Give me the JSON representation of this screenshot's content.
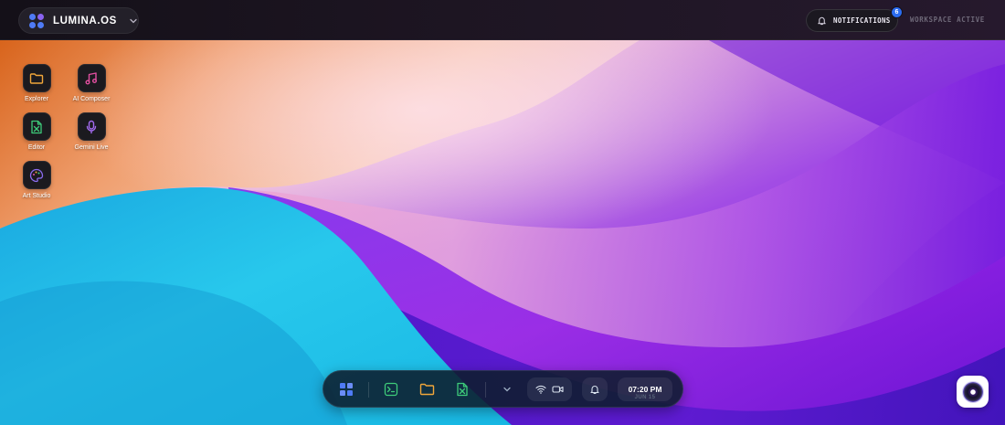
{
  "topbar": {
    "brand_name": "LUMINA.OS",
    "brand_icon": "apps-grid-icon",
    "brand_menu_icon": "chevron-down-icon",
    "notifications": {
      "label": "NOTIFICATIONS",
      "icon": "bell-icon",
      "count": "6"
    },
    "workspace_status": "WORKSPACE ACTIVE"
  },
  "desktop": {
    "icons": [
      {
        "label": "Explorer",
        "icon": "folder-icon",
        "color": "#f0a63a"
      },
      {
        "label": "AI Composer",
        "icon": "music-note-icon",
        "color": "#e24fa0"
      },
      {
        "label": "Editor",
        "icon": "spreadsheet-icon",
        "color": "#3ecb7a"
      },
      {
        "label": "Gemini Live",
        "icon": "microphone-icon",
        "color": "#a46bf0"
      },
      {
        "label": "Art Studio",
        "icon": "palette-icon",
        "color": "#8b6cf0"
      }
    ]
  },
  "dock": {
    "apps": [
      {
        "name": "launcher",
        "icon": "apps-grid-icon"
      },
      {
        "name": "terminal",
        "icon": "terminal-icon"
      },
      {
        "name": "explorer",
        "icon": "folder-icon"
      },
      {
        "name": "editor",
        "icon": "spreadsheet-icon"
      }
    ],
    "expand_icon": "chevron-down-icon",
    "status_icons": [
      "wifi-icon",
      "video-camera-icon"
    ],
    "alerts_icon": "bell-icon",
    "clock": {
      "time": "07:20 PM",
      "date": "JUN 15"
    }
  },
  "assistant": {
    "icon": "assistant-orb-icon"
  },
  "colors": {
    "accent_blue": "#2b6cf0",
    "accent_purple": "#8a63f0",
    "terminal_green": "#3ecb7a",
    "folder_orange": "#f0a63a"
  }
}
